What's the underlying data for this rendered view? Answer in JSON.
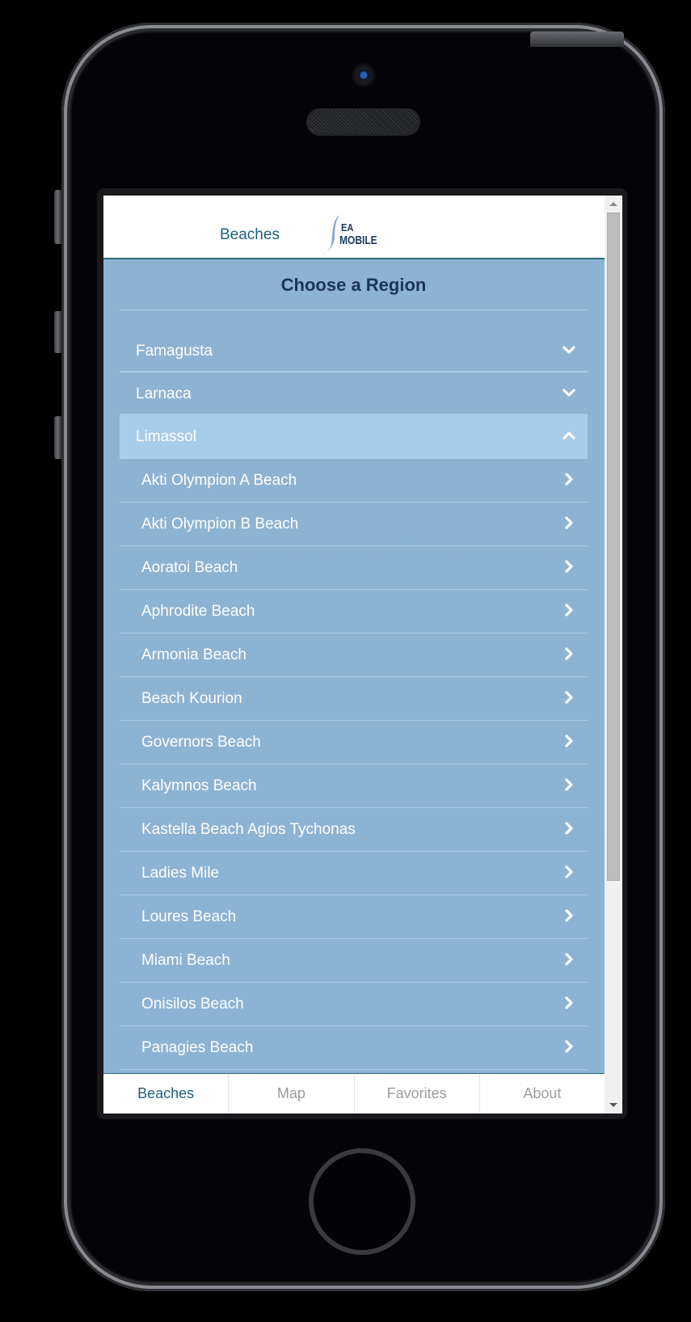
{
  "header": {
    "title": "Beaches",
    "logo": {
      "line1": "EA",
      "line2": "MOBILE",
      "icon": "sea-mobile-logo-icon"
    }
  },
  "main": {
    "heading": "Choose a Region",
    "regions": [
      {
        "label": "Famagusta",
        "expanded": false,
        "icon": "chevron-down-icon"
      },
      {
        "label": "Larnaca",
        "expanded": false,
        "icon": "chevron-down-icon"
      },
      {
        "label": "Limassol",
        "expanded": true,
        "icon": "chevron-up-icon"
      }
    ],
    "limassol_beaches": [
      "Akti Olympion A Beach",
      "Akti Olympion B Beach",
      "Aoratoi Beach",
      "Aphrodite Beach",
      "Armonia Beach",
      "Beach Kourion",
      "Governors Beach",
      "Kalymnos Beach",
      "Kastella Beach Agios Tychonas",
      "Ladies Mile",
      "Loures Beach",
      "Miami Beach",
      "Onisilos Beach",
      "Panagies Beach"
    ],
    "row_icon": "chevron-right-icon"
  },
  "tabs": [
    {
      "label": "Beaches",
      "active": true
    },
    {
      "label": "Map",
      "active": false
    },
    {
      "label": "Favorites",
      "active": false
    },
    {
      "label": "About",
      "active": false
    }
  ],
  "colors": {
    "accent": "#1f5f80",
    "content_bg": "#8eb3d2",
    "open_region_bg": "#a7cdeb",
    "heading": "#1b3558"
  }
}
